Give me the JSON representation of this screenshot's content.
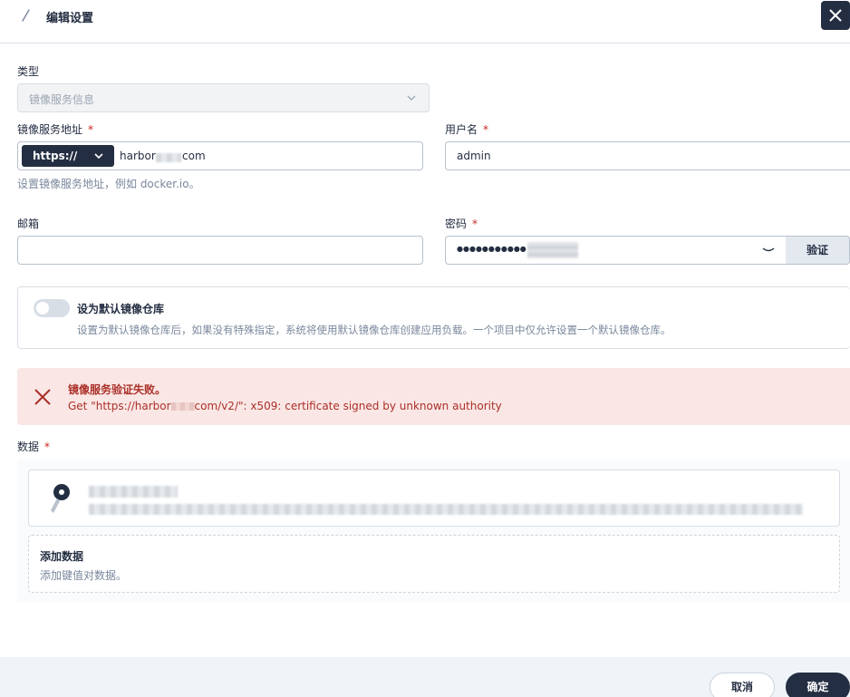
{
  "header": {
    "title": "编辑设置",
    "close_icon": "close-icon"
  },
  "form": {
    "type": {
      "label": "类型",
      "value": "镜像服务信息"
    },
    "registry": {
      "label": "镜像服务地址",
      "required_mark": "*",
      "protocol": "https://",
      "host_prefix": "harbor",
      "host_suffix": "com",
      "hint": "设置镜像服务地址，例如 docker.io。"
    },
    "username": {
      "label": "用户名",
      "required_mark": "*",
      "value": "admin"
    },
    "email": {
      "label": "邮箱",
      "value": ""
    },
    "password": {
      "label": "密码",
      "required_mark": "*",
      "masked": "●●●●●●●●●●●",
      "verify_label": "验证"
    },
    "default_registry": {
      "title": "设为默认镜像仓库",
      "description": "设置为默认镜像仓库后，如果没有特殊指定，系统将使用默认镜像仓库创建应用负载。一个项目中仅允许设置一个默认镜像仓库。",
      "enabled": false
    }
  },
  "error": {
    "title": "镜像服务验证失败。",
    "message_prefix": "Get \"https://harbor",
    "message_suffix": "com/v2/\": x509: certificate signed by unknown authority"
  },
  "data_section": {
    "label": "数据",
    "required_mark": "*",
    "add_title": "添加数据",
    "add_desc": "添加键值对数据。"
  },
  "footer": {
    "cancel_label": "取消",
    "ok_label": "确定"
  },
  "colors": {
    "primary": "#242e42",
    "error_bg": "#fae7e5",
    "error_text": "#ab2f29",
    "required": "#ca2621"
  }
}
